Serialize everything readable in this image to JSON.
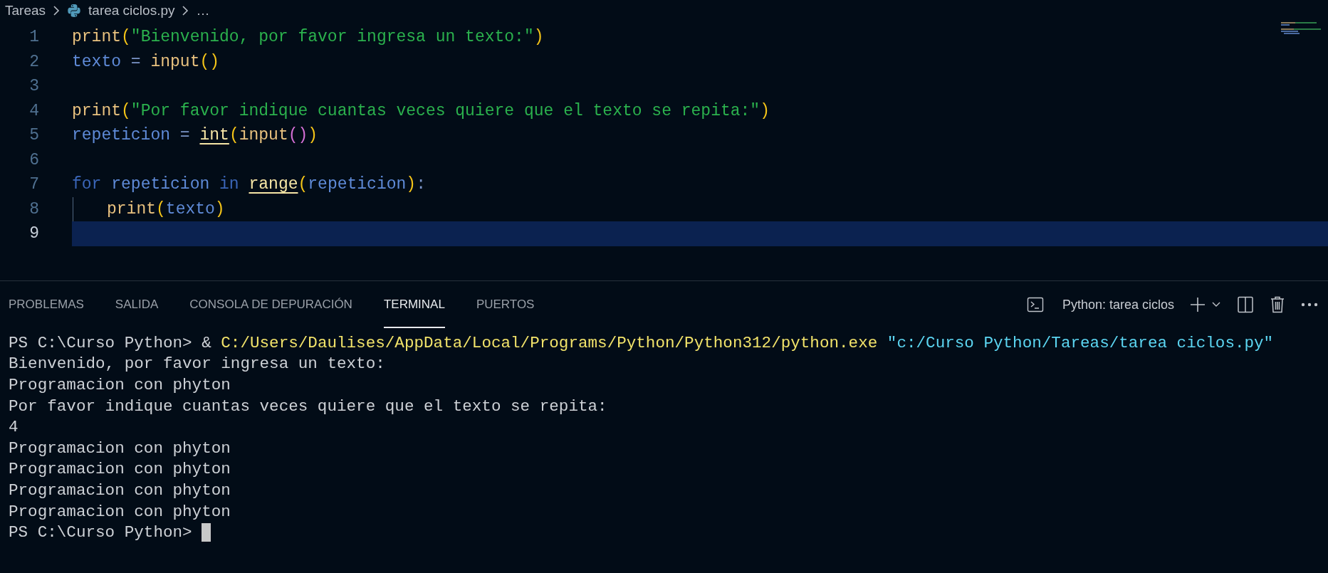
{
  "breadcrumb": {
    "items": [
      {
        "kind": "folder",
        "label": "Tareas"
      },
      {
        "kind": "python_file",
        "label": "tarea ciclos.py"
      },
      {
        "kind": "more",
        "label": "…"
      }
    ]
  },
  "editor": {
    "lines": [
      {
        "number": "1",
        "active": false,
        "tokens": [
          {
            "kind": "fn",
            "text": "print"
          },
          {
            "kind": "paren",
            "text": "("
          },
          {
            "kind": "string",
            "text": "\"Bienvenido, por favor ingresa un texto:\""
          },
          {
            "kind": "paren",
            "text": ")"
          }
        ]
      },
      {
        "number": "2",
        "active": false,
        "tokens": [
          {
            "kind": "var",
            "text": "texto"
          },
          {
            "kind": "op",
            "text": " = "
          },
          {
            "kind": "fn",
            "text": "input"
          },
          {
            "kind": "paren",
            "text": "()"
          }
        ]
      },
      {
        "number": "3",
        "active": false
      },
      {
        "number": "4",
        "active": false,
        "tokens": [
          {
            "kind": "fn",
            "text": "print"
          },
          {
            "kind": "paren",
            "text": "("
          },
          {
            "kind": "string",
            "text": "\"Por favor indique cuantas veces quiere que el texto se repita:\""
          },
          {
            "kind": "paren",
            "text": ")"
          }
        ]
      },
      {
        "number": "5",
        "active": false,
        "tokens": [
          {
            "kind": "var",
            "text": "repeticion"
          },
          {
            "kind": "op",
            "text": " = "
          },
          {
            "kind": "builtin_marked",
            "text": "int"
          },
          {
            "kind": "paren",
            "text": "("
          },
          {
            "kind": "fn",
            "text": "input"
          },
          {
            "kind": "paren2",
            "text": "()"
          },
          {
            "kind": "paren",
            "text": ")"
          }
        ]
      },
      {
        "number": "6",
        "active": false
      },
      {
        "number": "7",
        "active": false,
        "tokens": [
          {
            "kind": "keyword",
            "text": "for "
          },
          {
            "kind": "var",
            "text": "repeticion "
          },
          {
            "kind": "keyword",
            "text": "in "
          },
          {
            "kind": "builtin_marked",
            "text": "range"
          },
          {
            "kind": "paren",
            "text": "("
          },
          {
            "kind": "var",
            "text": "repeticion"
          },
          {
            "kind": "paren",
            "text": ")"
          },
          {
            "kind": "op",
            "text": ":"
          }
        ]
      },
      {
        "number": "8",
        "active": false,
        "indent_guide": true,
        "tokens": [
          {
            "kind": "fn",
            "text": "print"
          },
          {
            "kind": "paren",
            "text": "("
          },
          {
            "kind": "var",
            "text": "texto"
          },
          {
            "kind": "paren",
            "text": ")"
          }
        ]
      },
      {
        "number": "9",
        "active": true
      }
    ]
  },
  "panel": {
    "tabs": [
      {
        "label": "PROBLEMAS",
        "selected": false
      },
      {
        "label": "SALIDA",
        "selected": false
      },
      {
        "label": "CONSOLA DE DEPURACIÓN",
        "selected": false
      },
      {
        "label": "TERMINAL",
        "selected": true
      },
      {
        "label": "PUERTOS",
        "selected": false
      }
    ],
    "terminal_name": "Python: tarea ciclos"
  },
  "terminal": {
    "lines": [
      {
        "cursor": false,
        "segments": [
          {
            "kind": "plain",
            "text": "PS C:\\Curso Python> & "
          },
          {
            "kind": "path",
            "text": "C:/Users/Daulises/AppData/Local/Programs/Python/Python312/python.exe "
          },
          {
            "kind": "quoted",
            "text": "\"c:/Curso Python/Tareas/tarea ciclos.py\""
          }
        ]
      },
      {
        "cursor": false,
        "segments": [
          {
            "kind": "plain",
            "text": "Bienvenido, por favor ingresa un texto:"
          }
        ]
      },
      {
        "cursor": false,
        "segments": [
          {
            "kind": "plain",
            "text": "Programacion con phyton"
          }
        ]
      },
      {
        "cursor": false,
        "segments": [
          {
            "kind": "plain",
            "text": "Por favor indique cuantas veces quiere que el texto se repita:"
          }
        ]
      },
      {
        "cursor": false,
        "segments": [
          {
            "kind": "plain",
            "text": "4"
          }
        ]
      },
      {
        "cursor": false,
        "segments": [
          {
            "kind": "plain",
            "text": "Programacion con phyton"
          }
        ]
      },
      {
        "cursor": false,
        "segments": [
          {
            "kind": "plain",
            "text": "Programacion con phyton"
          }
        ]
      },
      {
        "cursor": false,
        "segments": [
          {
            "kind": "plain",
            "text": "Programacion con phyton"
          }
        ]
      },
      {
        "cursor": false,
        "segments": [
          {
            "kind": "plain",
            "text": "Programacion con phyton"
          }
        ]
      },
      {
        "cursor": true,
        "segments": [
          {
            "kind": "plain",
            "text": "PS C:\\Curso Python> "
          }
        ]
      }
    ]
  }
}
